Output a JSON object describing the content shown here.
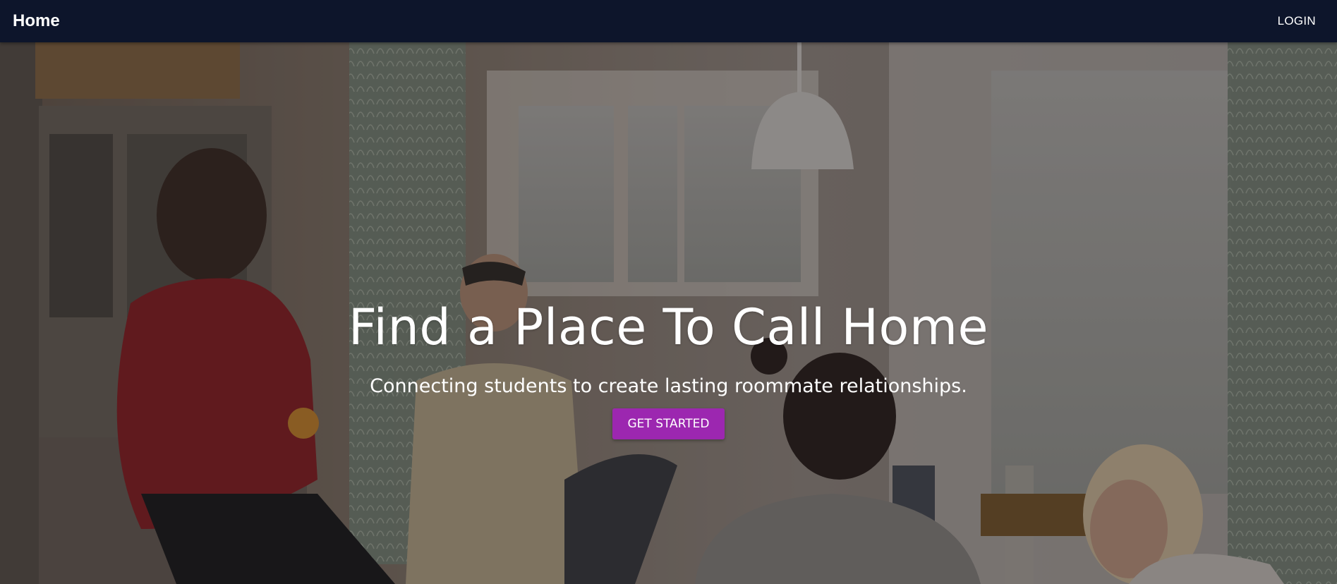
{
  "navbar": {
    "brand": "Home",
    "login_label": "LOGIN"
  },
  "hero": {
    "title": "Find a Place To Call Home",
    "subtitle": "Connecting students to create lasting roommate relationships.",
    "cta_label": "GET STARTED",
    "cta_color": "#9c27b0"
  },
  "colors": {
    "navbar_bg": "#0d152b",
    "text": "#ffffff"
  }
}
